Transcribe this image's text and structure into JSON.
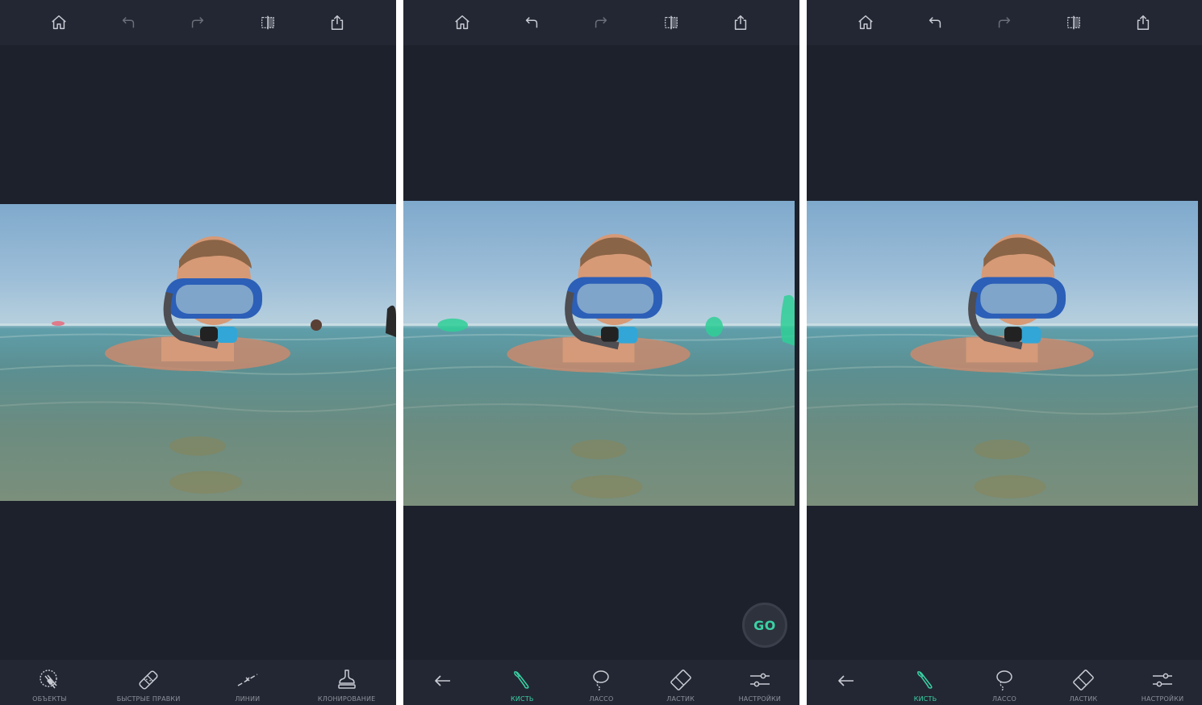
{
  "topbar": {
    "buttons": [
      {
        "icon": "home-icon"
      },
      {
        "icon": "undo-icon"
      },
      {
        "icon": "redo-icon"
      },
      {
        "icon": "compare-icon"
      },
      {
        "icon": "share-icon"
      }
    ]
  },
  "panel1": {
    "tools": [
      {
        "icon": "objects-icon",
        "label": "ОБЪЕКТЫ"
      },
      {
        "icon": "quick-fix-icon",
        "label": "БЫСТРЫЕ ПРАВКИ"
      },
      {
        "icon": "lines-icon",
        "label": "ЛИНИИ"
      },
      {
        "icon": "clone-stamp-icon",
        "label": "КЛОНИРОВАНИЕ"
      }
    ]
  },
  "panel2": {
    "go_label": "GO",
    "tools": [
      {
        "icon": "back-arrow-icon",
        "label": ""
      },
      {
        "icon": "brush-icon",
        "label": "КИСТЬ",
        "active": true
      },
      {
        "icon": "lasso-icon",
        "label": "ЛАССО"
      },
      {
        "icon": "eraser-icon",
        "label": "ЛАСТИК"
      },
      {
        "icon": "settings-sliders-icon",
        "label": "НАСТРОЙКИ"
      }
    ]
  },
  "panel3": {
    "tools": [
      {
        "icon": "back-arrow-icon",
        "label": ""
      },
      {
        "icon": "brush-icon",
        "label": "КИСТЬ",
        "active": true
      },
      {
        "icon": "lasso-icon",
        "label": "ЛАССО"
      },
      {
        "icon": "eraser-icon",
        "label": "ЛАСТИК"
      },
      {
        "icon": "settings-sliders-icon",
        "label": "НАСТРОЙКИ"
      }
    ]
  },
  "colors": {
    "background": "#1d212c",
    "bar": "#232733",
    "accent": "#3ad2a4",
    "icon": "#c9ccd3",
    "icon_disabled": "#6b6f7a"
  }
}
